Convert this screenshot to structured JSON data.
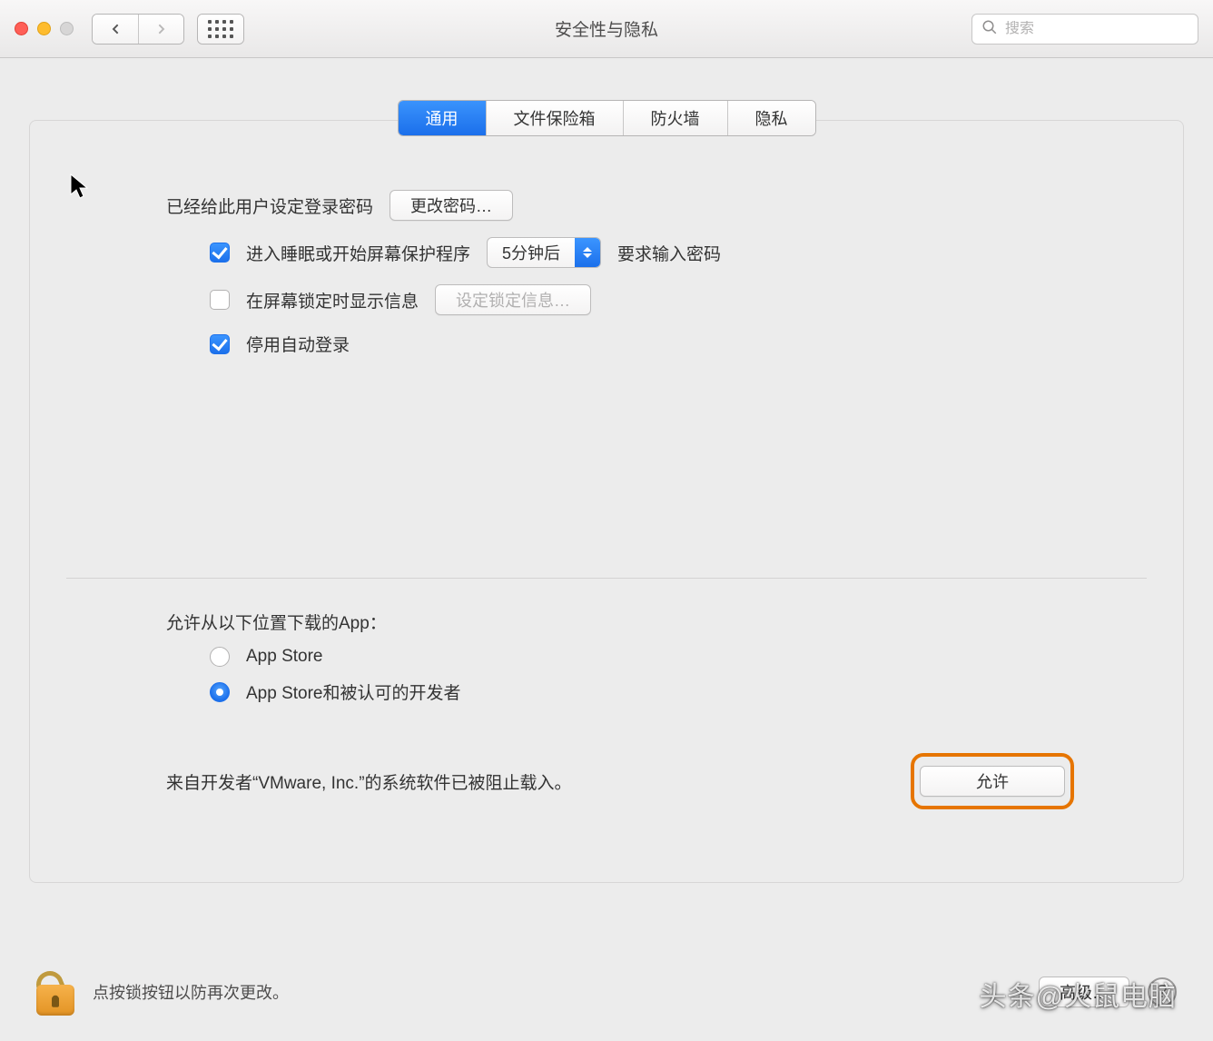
{
  "window": {
    "title": "安全性与隐私"
  },
  "toolbar": {
    "search_placeholder": "搜索"
  },
  "tabs": {
    "general": "通用",
    "filevault": "文件保险箱",
    "firewall": "防火墙",
    "privacy": "隐私",
    "active": "通用"
  },
  "general": {
    "password_set_label": "已经给此用户设定登录密码",
    "change_password_button": "更改密码…",
    "require_password_checkbox_label_pre": "进入睡眠或开始屏幕保护程序",
    "require_password_select_value": "5分钟后",
    "require_password_checkbox_label_post": "要求输入密码",
    "require_password_checked": true,
    "lock_message_checkbox_label": "在屏幕锁定时显示信息",
    "lock_message_checked": false,
    "set_lock_message_button": "设定锁定信息…",
    "disable_autologin_label": "停用自动登录",
    "disable_autologin_checked": true
  },
  "downloads": {
    "heading": "允许从以下位置下载的App：",
    "option_appstore": "App Store",
    "option_identified": "App Store和被认可的开发者",
    "selected": "identified"
  },
  "blocked": {
    "message": "来自开发者“VMware, Inc.”的系统软件已被阻止载入。",
    "allow_button": "允许"
  },
  "footer": {
    "lock_hint": "点按锁按钮以防再次更改。",
    "advanced_button": "高级…"
  },
  "watermark": "头条@火鼠电脑"
}
